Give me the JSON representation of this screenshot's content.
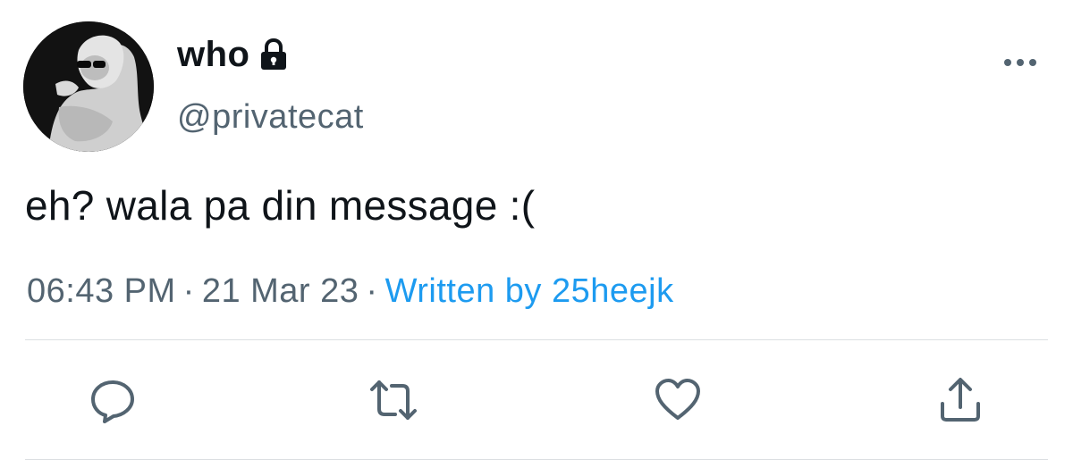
{
  "user": {
    "display_name": "who",
    "handle": "@privatecat",
    "verified_lock_icon": "lock-icon",
    "avatar_icon": "avatar"
  },
  "tweet": {
    "text": "eh? wala pa din message :("
  },
  "meta": {
    "time": "06:43 PM",
    "separator": "·",
    "date": "21 Mar 23",
    "written_by": "Written by 25heejk"
  },
  "menu": {
    "icon": "more-icon"
  },
  "actions": [
    {
      "name": "reply",
      "icon": "reply-icon"
    },
    {
      "name": "retweet",
      "icon": "retweet-icon"
    },
    {
      "name": "like",
      "icon": "heart-icon"
    },
    {
      "name": "share",
      "icon": "share-icon"
    }
  ],
  "colors": {
    "text": "#0f1419",
    "secondary": "#536471",
    "link": "#1d9bf0",
    "divider": "#dcdfe2"
  }
}
